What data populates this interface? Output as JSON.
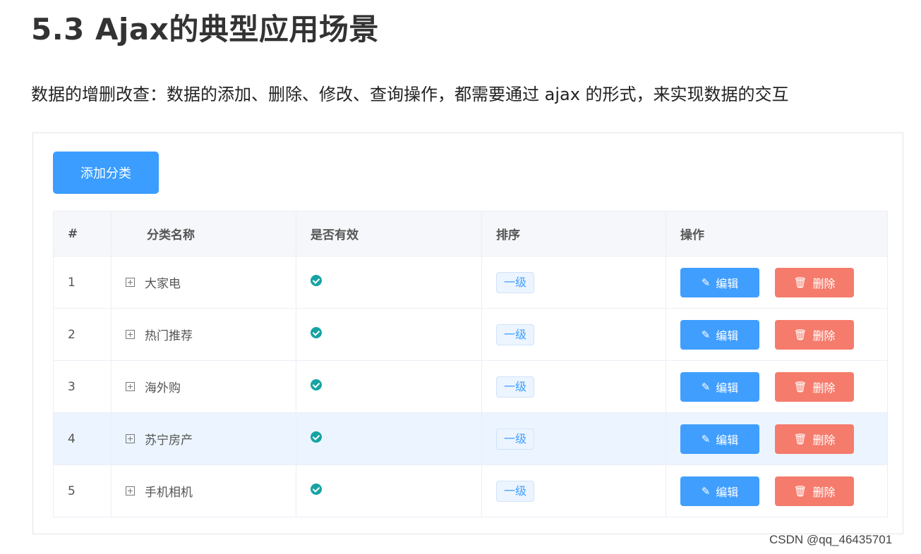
{
  "heading": "5.3 Ajax的典型应用场景",
  "description": "数据的增删改查：数据的添加、删除、修改、查询操作，都需要通过 ajax 的形式，来实现数据的交互",
  "toolbar": {
    "add_label": "添加分类"
  },
  "table": {
    "headers": {
      "index": "#",
      "name": "分类名称",
      "valid": "是否有效",
      "sort": "排序",
      "ops": "操作"
    },
    "rows": [
      {
        "index": "1",
        "name": "大家电",
        "level": "一级",
        "edit": "编辑",
        "delete": "删除"
      },
      {
        "index": "2",
        "name": "热门推荐",
        "level": "一级",
        "edit": "编辑",
        "delete": "删除"
      },
      {
        "index": "3",
        "name": "海外购",
        "level": "一级",
        "edit": "编辑",
        "delete": "删除"
      },
      {
        "index": "4",
        "name": "苏宁房产",
        "level": "一级",
        "edit": "编辑",
        "delete": "删除"
      },
      {
        "index": "5",
        "name": "手机相机",
        "level": "一级",
        "edit": "编辑",
        "delete": "删除"
      }
    ]
  },
  "icons": {
    "expand": "plus-square-icon",
    "valid": "check-circle-icon",
    "edit": "pencil-icon",
    "delete": "trash-icon"
  },
  "colors": {
    "primary": "#409eff",
    "danger": "#f57b6c",
    "valid": "#16a3a4",
    "highlight_row": "#ecf5ff"
  },
  "watermark": "CSDN @qq_46435701"
}
